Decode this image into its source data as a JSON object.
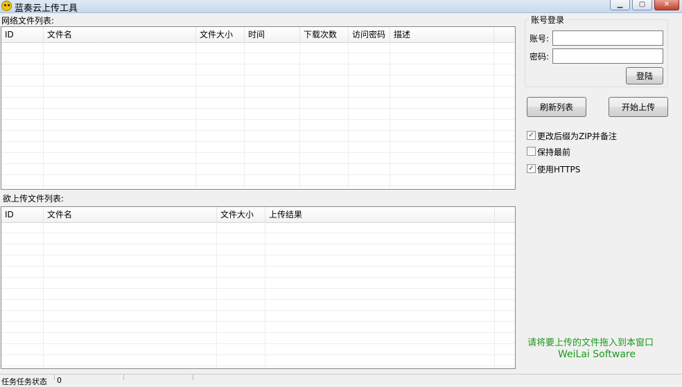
{
  "window": {
    "title": "蓝奏云上传工具",
    "buttons": {
      "minimize": "▁",
      "maximize": "▢",
      "close": "✕"
    }
  },
  "network_list": {
    "label": "网络文件列表:",
    "columns": [
      "ID",
      "文件名",
      "文件大小",
      "时间",
      "下载次数",
      "访问密码",
      "描述"
    ],
    "rows": []
  },
  "upload_list": {
    "label": "欲上传文件列表:",
    "columns": [
      "ID",
      "文件名",
      "文件大小",
      "上传结果"
    ],
    "rows": []
  },
  "login": {
    "group_title": "账号登录",
    "account_label": "账号:",
    "account_value": "",
    "password_label": "密码:",
    "password_value": "",
    "login_button": "登陆"
  },
  "actions": {
    "refresh_button": "刷新列表",
    "upload_button": "开始上传"
  },
  "options": [
    {
      "label": "更改后缀为ZIP并备注",
      "checked": true
    },
    {
      "label": "保持最前",
      "checked": false
    },
    {
      "label": "使用HTTPS",
      "checked": true
    }
  ],
  "hint": {
    "drag_text": "请将要上传的文件拖入到本窗口",
    "brand": "WeiLai Software",
    "color": "#1a9a1a"
  },
  "statusbar": {
    "segment1": "任务任务状态",
    "segment2": "0"
  }
}
